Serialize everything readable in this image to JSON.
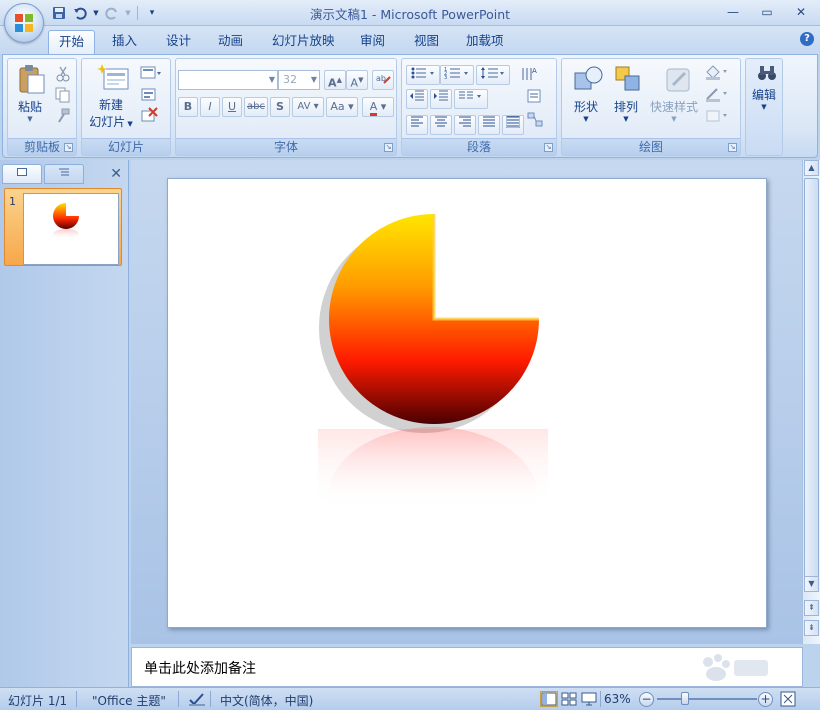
{
  "titlebar": {
    "title": "演示文稿1 - Microsoft PowerPoint"
  },
  "tabs": [
    {
      "label": "开始",
      "active": true
    },
    {
      "label": "插入"
    },
    {
      "label": "设计"
    },
    {
      "label": "动画"
    },
    {
      "label": "幻灯片放映"
    },
    {
      "label": "审阅"
    },
    {
      "label": "视图"
    },
    {
      "label": "加载项"
    }
  ],
  "ribbon": {
    "clipboard": {
      "group_label": "剪贴板",
      "paste_label": "粘贴"
    },
    "slides": {
      "group_label": "幻灯片",
      "new_slide_line1": "新建",
      "new_slide_line2": "幻灯片"
    },
    "font": {
      "group_label": "字体",
      "font_size": "32",
      "bold": "B",
      "italic": "I",
      "underline": "U",
      "strike": "abc",
      "shadow": "S",
      "spacing": "AV",
      "case": "Aa",
      "color": "A"
    },
    "paragraph": {
      "group_label": "段落"
    },
    "drawing": {
      "group_label": "绘图",
      "shapes_label": "形状",
      "arrange_label": "排列",
      "quick_styles_label": "快速样式"
    },
    "editing": {
      "label": "编辑"
    }
  },
  "slides_panel": {
    "thumb_number": "1"
  },
  "notes": {
    "placeholder": "单击此处添加备注"
  },
  "status": {
    "slide_info": "幻灯片 1/1",
    "theme": "\"Office 主题\"",
    "language": "中文(简体，中国)",
    "zoom": "63%"
  },
  "colors": {
    "ribbon_accent": "#15428b",
    "pie_top": "#ffe000",
    "pie_mid": "#ff2a00",
    "pie_bottom": "#5a0000"
  }
}
